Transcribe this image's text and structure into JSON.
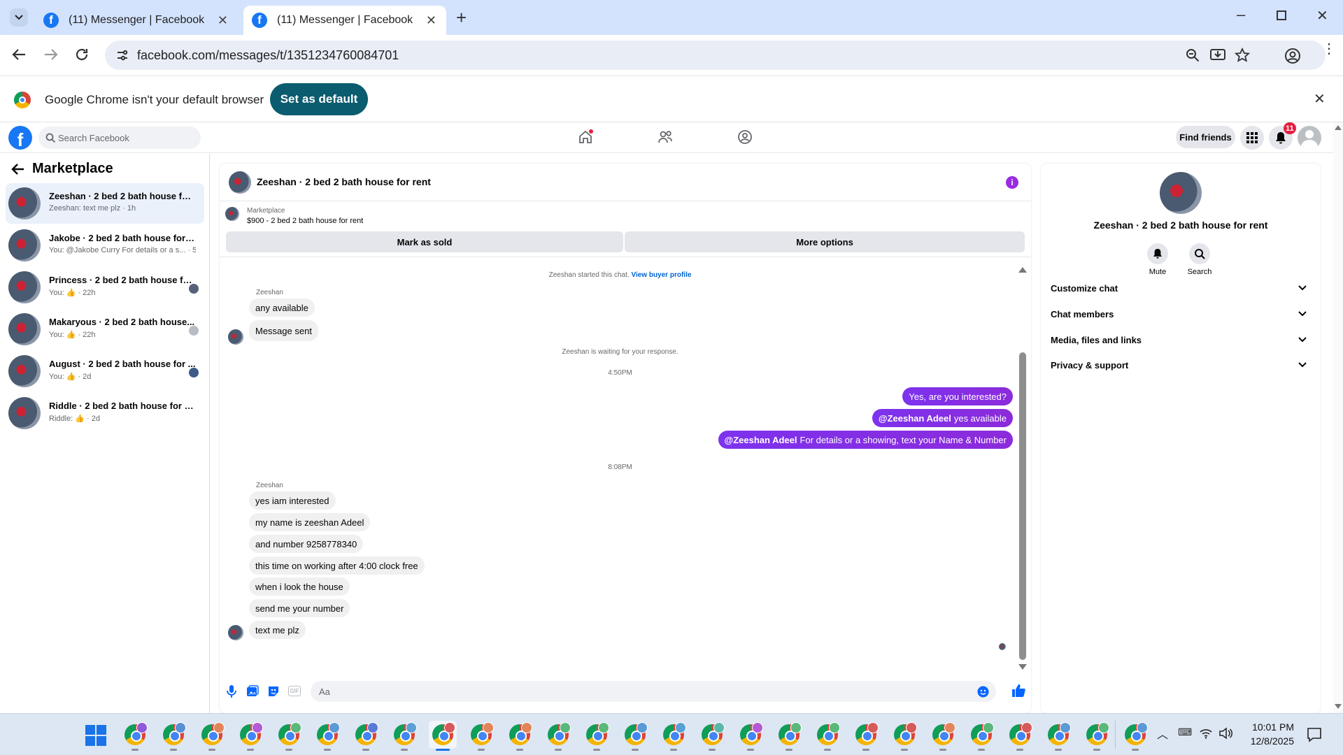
{
  "browser": {
    "tabs": [
      {
        "title": "(11) Messenger | Facebook"
      },
      {
        "title": "(11) Messenger | Facebook"
      }
    ],
    "url": "facebook.com/messages/t/1351234760084701",
    "infobar_text": "Google Chrome isn't your default browser",
    "set_default_label": "Set as default"
  },
  "fb": {
    "search_placeholder": "Search Facebook",
    "find_friends": "Find friends",
    "notif_count": "11"
  },
  "left": {
    "title": "Marketplace",
    "conversations": [
      {
        "title": "Zeeshan · 2 bed 2 bath house for r...",
        "sub": "Zeeshan: text me plz · 1h"
      },
      {
        "title": "Jakobe · 2 bed 2 bath house for rent",
        "sub": "You: @Jakobe Curry For details or a s... · 5h"
      },
      {
        "title": "Princess · 2 bed 2 bath house fo...",
        "sub": "You: 👍 · 22h"
      },
      {
        "title": "Makaryous · 2 bed 2 bath house...",
        "sub": "You: 👍 · 22h"
      },
      {
        "title": "August · 2 bed 2 bath house for ...",
        "sub": "You: 👍 · 2d"
      },
      {
        "title": "Riddle · 2 bed 2 bath house for rent",
        "sub": "Riddle: 👍 · 2d"
      }
    ]
  },
  "chat": {
    "title": "Zeeshan · 2 bed 2 bath house for rent",
    "marketplace_label": "Marketplace",
    "listing": "$900 - 2 bed 2 bath house for rent",
    "mark_sold": "Mark as sold",
    "more_options": "More options",
    "started_text": "Zeeshan started this chat.",
    "view_profile": "View buyer profile",
    "sender1": "Zeeshan",
    "msgs1": [
      "any available",
      "Message sent"
    ],
    "waiting": "Zeeshan is waiting for your response.",
    "time1": "4:50PM",
    "out": [
      {
        "mention": "",
        "text": "Yes, are you interested?"
      },
      {
        "mention": "@Zeeshan Adeel",
        "text": "yes available"
      },
      {
        "mention": "@Zeeshan Adeel",
        "text": "For details or a showing, text your Name & Number"
      }
    ],
    "time2": "8:08PM",
    "sender2": "Zeeshan",
    "msgs2": [
      "yes iam interested",
      "my name is zeeshan Adeel",
      "and number 9258778340",
      "this time on working after 4:00 clock free",
      "when i look the house",
      "send me your number",
      "text me plz"
    ],
    "composer_placeholder": "Aa"
  },
  "right": {
    "title": "Zeeshan · 2 bed 2 bath house for rent",
    "mute": "Mute",
    "search": "Search",
    "sections": [
      "Customize chat",
      "Chat members",
      "Media, files and links",
      "Privacy & support"
    ]
  },
  "taskbar": {
    "time": "10:01 PM",
    "date": "12/8/2025",
    "icon_count": 27
  }
}
